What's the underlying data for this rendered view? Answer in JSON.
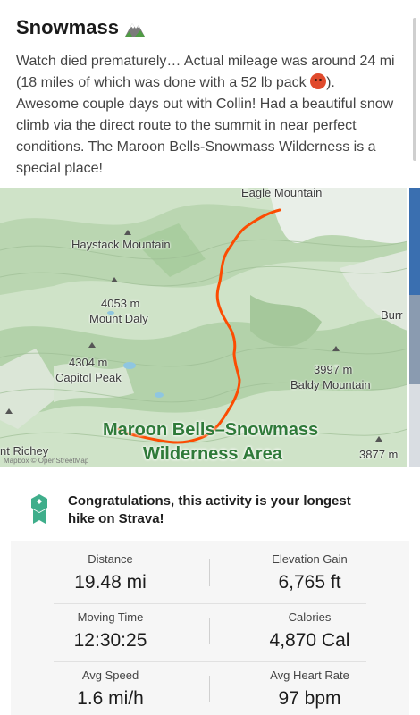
{
  "activity": {
    "title": "Snowmass",
    "title_icon": "mountain-icon",
    "description": "Watch died prematurely… Actual mileage was around 24 mi (18 miles of which was done with a 52 lb pack",
    "description_tail": "). Awesome couple days out with Collin! Had a beautiful snow climb via the direct route to the summit in near perfect conditions. The Maroon Bells-Snowmass Wilderness is a special place!",
    "emoji_icon": "angry-face-icon"
  },
  "map": {
    "labels": {
      "eagle": "Eagle Mountain",
      "haystack": "Haystack Mountain",
      "daly_elev": "4053 m",
      "daly": "Mount Daly",
      "capitol_elev": "4304 m",
      "capitol": "Capitol Peak",
      "baldy_elev": "3997 m",
      "baldy": "Baldy Mountain",
      "burr": "Burr",
      "richey": "nt Richey",
      "right_elev": "3877 m",
      "wilderness1": "Maroon Bells–Snowmass",
      "wilderness2": "Wilderness Area"
    },
    "attribution": "Mapbox © OpenStreetMap",
    "route_color": "#fc4c02"
  },
  "achievement": {
    "text": "Congratulations, this activity is your longest hike on Strava!",
    "icon": "achievement-badge-icon",
    "color": "#3fae8b"
  },
  "stats": {
    "distance_label": "Distance",
    "distance_value": "19.48 mi",
    "elevation_label": "Elevation Gain",
    "elevation_value": "6,765 ft",
    "moving_time_label": "Moving Time",
    "moving_time_value": "12:30:25",
    "calories_label": "Calories",
    "calories_value": "4,870 Cal",
    "avg_speed_label": "Avg Speed",
    "avg_speed_value": "1.6 mi/h",
    "avg_hr_label": "Avg Heart Rate",
    "avg_hr_value": "97 bpm"
  }
}
